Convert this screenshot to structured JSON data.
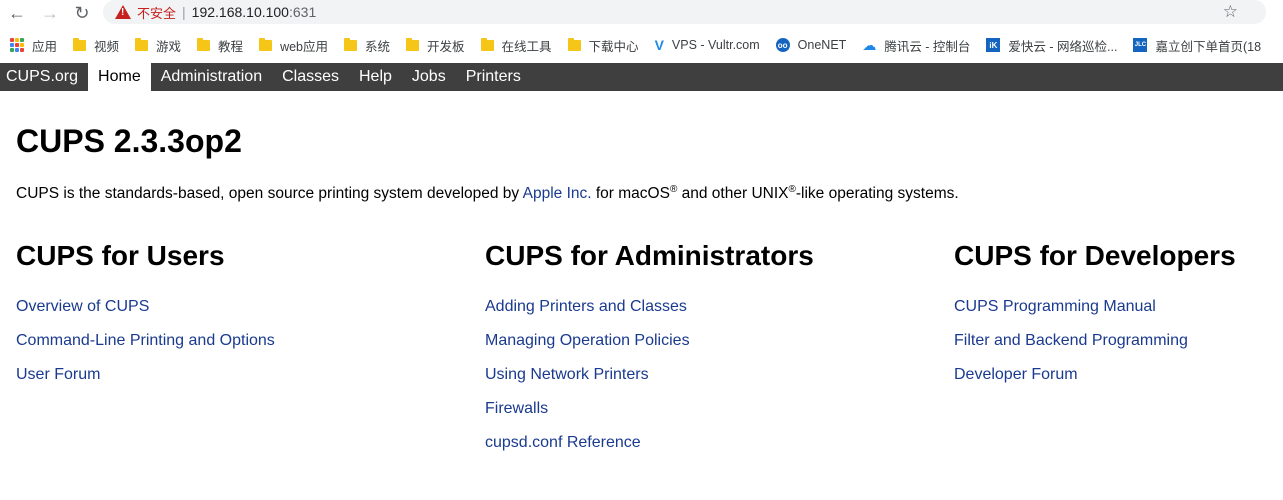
{
  "browser": {
    "security_label": "不安全",
    "url_host": "192.168.10.100",
    "url_port": ":631",
    "bookmarks": [
      {
        "label": "应用",
        "icon": "apps-grid-icon"
      },
      {
        "label": "视频",
        "icon": "folder-icon"
      },
      {
        "label": "游戏",
        "icon": "folder-icon"
      },
      {
        "label": "教程",
        "icon": "folder-icon"
      },
      {
        "label": "web应用",
        "icon": "folder-icon"
      },
      {
        "label": "系统",
        "icon": "folder-icon"
      },
      {
        "label": "开发板",
        "icon": "folder-icon"
      },
      {
        "label": "在线工具",
        "icon": "folder-icon"
      },
      {
        "label": "下载中心",
        "icon": "folder-icon"
      },
      {
        "label": "VPS - Vultr.com",
        "icon": "vultr-icon"
      },
      {
        "label": "OneNET",
        "icon": "onenet-icon"
      },
      {
        "label": "腾讯云 - 控制台",
        "icon": "cloud-icon"
      },
      {
        "label": "爱快云 - 网络巡检...",
        "icon": "ik-icon"
      },
      {
        "label": "嘉立创下单首页(18",
        "icon": "jlc-icon"
      }
    ]
  },
  "nav": {
    "items": [
      "CUPS.org",
      "Home",
      "Administration",
      "Classes",
      "Help",
      "Jobs",
      "Printers"
    ],
    "active": "Home"
  },
  "page": {
    "title": "CUPS 2.3.3op2",
    "intro_before": "CUPS is the standards-based, open source printing system developed by ",
    "intro_link": "Apple Inc.",
    "intro_mid": " for macOS",
    "intro_mid2": " and other UNIX",
    "intro_after": "-like operating systems.",
    "reg_mark": "®"
  },
  "sections": {
    "users": {
      "heading": "CUPS for Users",
      "links": [
        "Overview of CUPS",
        "Command-Line Printing and Options",
        "User Forum"
      ]
    },
    "admins": {
      "heading": "CUPS for Administrators",
      "links": [
        "Adding Printers and Classes",
        "Managing Operation Policies",
        "Using Network Printers",
        "Firewalls",
        "cupsd.conf Reference"
      ]
    },
    "devs": {
      "heading": "CUPS for Developers",
      "links": [
        "CUPS Programming Manual",
        "Filter and Backend Programming",
        "Developer Forum"
      ]
    }
  },
  "colors": {
    "nav_bg": "#3f3f3f",
    "link": "#1a3a8f",
    "insecure": "#c5221f"
  }
}
